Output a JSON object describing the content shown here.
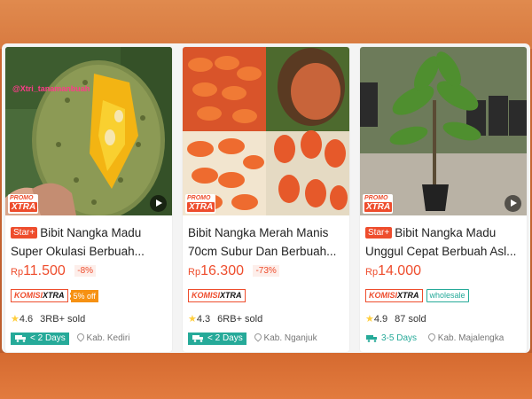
{
  "products": [
    {
      "title": "Bibit Nangka Madu Super Okulasi Berbuah...",
      "has_star_badge": true,
      "star_badge": "Star+",
      "watermark": "@Xtri_tanamanbuah",
      "promo_line1": "PROMO",
      "promo_line2": "XTRA",
      "has_video": true,
      "currency": "Rp",
      "price": "11.500",
      "discount": "-8%",
      "komisi_a": "KOMISI",
      "komisi_b": "XTRA",
      "extra_tag": "5% off",
      "rating": "4.6",
      "sold": "3RB+ sold",
      "delivery": "< 2 Days",
      "location": "Kab. Kediri"
    },
    {
      "title": "Bibit Nangka Merah Manis 70cm Subur Dan Berbuah...",
      "has_star_badge": false,
      "promo_line1": "PROMO",
      "promo_line2": "XTRA",
      "has_video": false,
      "currency": "Rp",
      "price": "16.300",
      "discount": "-73%",
      "komisi_a": "KOMISI",
      "komisi_b": "XTRA",
      "rating": "4.3",
      "sold": "6RB+ sold",
      "delivery": "< 2 Days",
      "location": "Kab. Nganjuk"
    },
    {
      "title": "Bibit Nangka Madu Unggul Cepat Berbuah Asl...",
      "has_star_badge": true,
      "star_badge": "Star+",
      "promo_line1": "PROMO",
      "promo_line2": "XTRA",
      "has_video": true,
      "currency": "Rp",
      "price": "14.000",
      "komisi_a": "KOMISI",
      "komisi_b": "XTRA",
      "extra_tag": "wholesale",
      "rating": "4.9",
      "sold": "87 sold",
      "delivery": "3-5 Days",
      "location": "Kab. Majalengka"
    }
  ],
  "colors": {
    "accent": "#ee4d2d",
    "teal": "#26aa99",
    "star": "#ffce3d",
    "discount_orange": "#f69113"
  }
}
